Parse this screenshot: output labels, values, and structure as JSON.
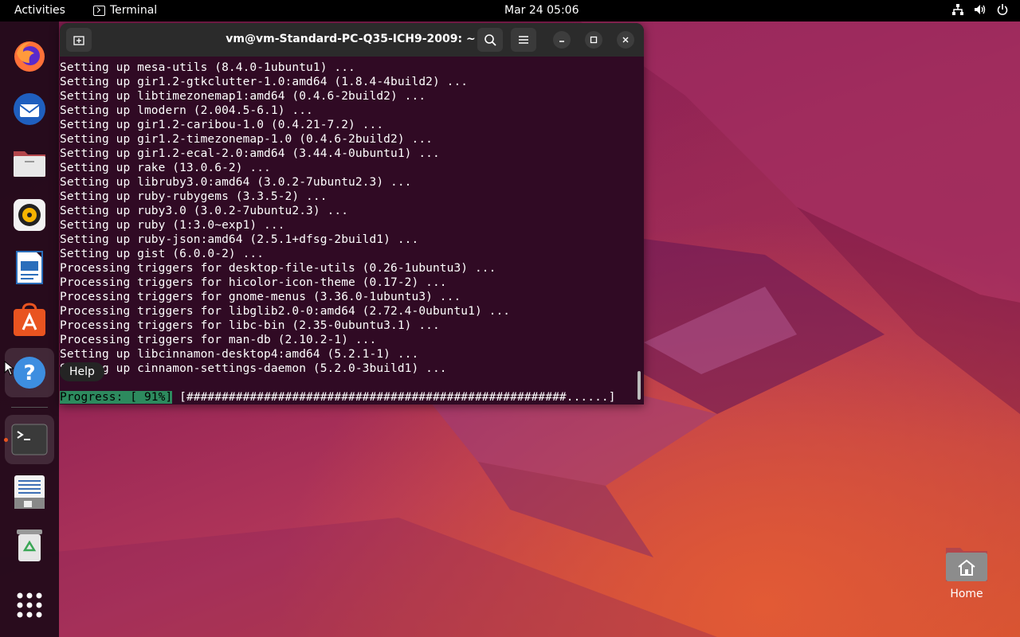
{
  "topbar": {
    "activities": "Activities",
    "app_name": "Terminal",
    "clock": "Mar 24  05:06",
    "status_icons": [
      "network-icon",
      "volume-icon",
      "power-icon"
    ]
  },
  "dock": {
    "items": [
      {
        "name": "firefox",
        "icon": "firefox-icon"
      },
      {
        "name": "thunderbird",
        "icon": "thunderbird-icon"
      },
      {
        "name": "files",
        "icon": "files-icon"
      },
      {
        "name": "rhythmbox",
        "icon": "rhythmbox-icon"
      },
      {
        "name": "libreoffice-writer",
        "icon": "writer-icon"
      },
      {
        "name": "app-center",
        "icon": "app-center-icon"
      },
      {
        "name": "help",
        "icon": "help-icon"
      },
      {
        "name": "terminal",
        "icon": "terminal-icon"
      },
      {
        "name": "text-editor",
        "icon": "text-editor-icon"
      },
      {
        "name": "trash",
        "icon": "trash-icon"
      },
      {
        "name": "show-apps",
        "icon": "apps-grid-icon"
      }
    ],
    "tooltip": "Help"
  },
  "terminal": {
    "title": "vm@vm-Standard-PC-Q35-ICH9-2009: ~",
    "lines": [
      "Setting up mesa-utils (8.4.0-1ubuntu1) ...",
      "Setting up gir1.2-gtkclutter-1.0:amd64 (1.8.4-4build2) ...",
      "Setting up libtimezonemap1:amd64 (0.4.6-2build2) ...",
      "Setting up lmodern (2.004.5-6.1) ...",
      "Setting up gir1.2-caribou-1.0 (0.4.21-7.2) ...",
      "Setting up gir1.2-timezonemap-1.0 (0.4.6-2build2) ...",
      "Setting up gir1.2-ecal-2.0:amd64 (3.44.4-0ubuntu1) ...",
      "Setting up rake (13.0.6-2) ...",
      "Setting up libruby3.0:amd64 (3.0.2-7ubuntu2.3) ...",
      "Setting up ruby-rubygems (3.3.5-2) ...",
      "Setting up ruby3.0 (3.0.2-7ubuntu2.3) ...",
      "Setting up ruby (1:3.0~exp1) ...",
      "Setting up ruby-json:amd64 (2.5.1+dfsg-2build1) ...",
      "Setting up gist (6.0.0-2) ...",
      "Processing triggers for desktop-file-utils (0.26-1ubuntu3) ...",
      "Processing triggers for hicolor-icon-theme (0.17-2) ...",
      "Processing triggers for gnome-menus (3.36.0-1ubuntu3) ...",
      "Processing triggers for libglib2.0-0:amd64 (2.72.4-0ubuntu1) ...",
      "Processing triggers for libc-bin (2.35-0ubuntu3.1) ...",
      "Processing triggers for man-db (2.10.2-1) ...",
      "Setting up libcinnamon-desktop4:amd64 (5.2.1-1) ...",
      "Setting up cinnamon-settings-daemon (5.2.0-3build1) ..."
    ],
    "progress_label": "Progress: [ 91%]",
    "progress_bar": " [######################################################......]"
  },
  "desktop": {
    "home_label": "Home"
  },
  "colors": {
    "terminal_bg": "#300a24",
    "progress_green": "#2d8a5e",
    "ubuntu_orange": "#e95420"
  }
}
